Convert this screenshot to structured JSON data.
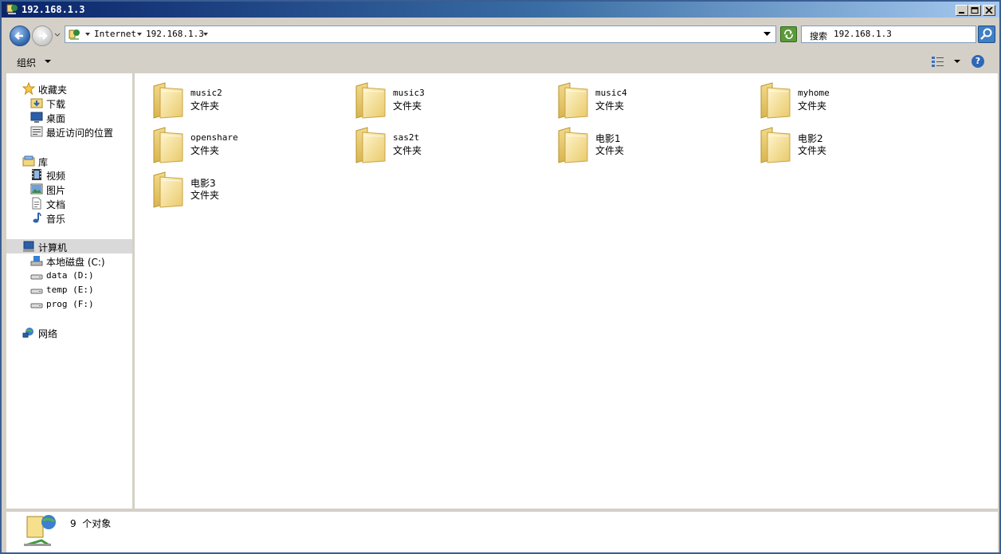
{
  "window": {
    "title": "192.168.1.3",
    "accent_color": "#3a6ea5"
  },
  "address": {
    "crumbs": [
      "Internet",
      "192.168.1.3"
    ]
  },
  "search": {
    "label": "搜索",
    "value": "192.168.1.3"
  },
  "toolbar": {
    "organize_label": "组织"
  },
  "nav": {
    "favorites": {
      "label": "收藏夹",
      "items": [
        "下载",
        "桌面",
        "最近访问的位置"
      ]
    },
    "libraries": {
      "label": "库",
      "items": [
        "视频",
        "图片",
        "文档",
        "音乐"
      ]
    },
    "computer": {
      "label": "计算机",
      "drives": [
        "本地磁盘 (C:)",
        "data (D:)",
        "temp (E:)",
        "prog (F:)"
      ]
    },
    "network": {
      "label": "网络"
    }
  },
  "folders": [
    {
      "name": "music2",
      "type": "文件夹"
    },
    {
      "name": "music3",
      "type": "文件夹"
    },
    {
      "name": "music4",
      "type": "文件夹"
    },
    {
      "name": "myhome",
      "type": "文件夹"
    },
    {
      "name": "openshare",
      "type": "文件夹"
    },
    {
      "name": "sas2t",
      "type": "文件夹"
    },
    {
      "name": "电影1",
      "type": "文件夹"
    },
    {
      "name": "电影2",
      "type": "文件夹"
    },
    {
      "name": "电影3",
      "type": "文件夹"
    }
  ],
  "status": {
    "count": "9",
    "label": "个对象"
  }
}
